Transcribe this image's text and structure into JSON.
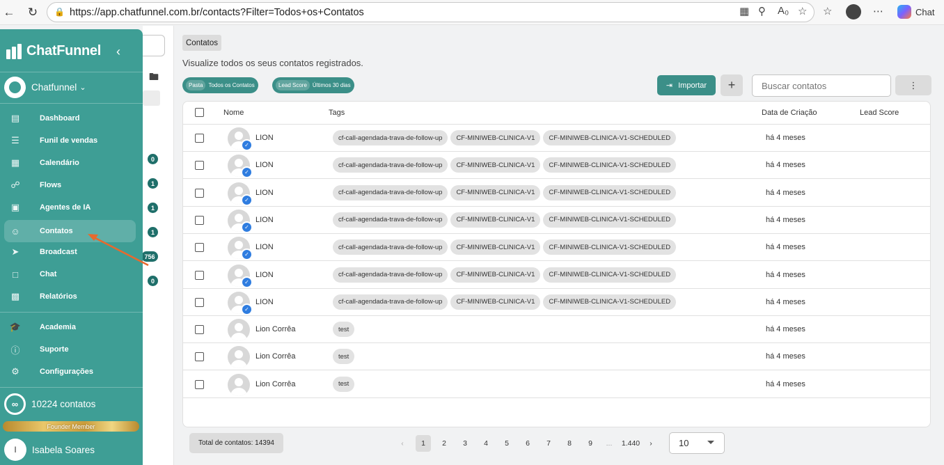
{
  "browser": {
    "url": "https://app.chatfunnel.com.br/contacts?Filter=Todos+os+Contatos",
    "copilot_label": "Chat"
  },
  "sidebar": {
    "brand": "ChatFunnel",
    "workspace": "Chatfunnel",
    "items": [
      {
        "label": "Dashboard",
        "icon": "dashboard-icon"
      },
      {
        "label": "Funil de vendas",
        "icon": "funnel-icon"
      },
      {
        "label": "Calendário",
        "icon": "calendar-icon"
      },
      {
        "label": "Flows",
        "icon": "flows-icon"
      },
      {
        "label": "Agentes de IA",
        "icon": "robot-icon"
      },
      {
        "label": "Contatos",
        "icon": "contacts-icon"
      },
      {
        "label": "Broadcast",
        "icon": "broadcast-icon"
      },
      {
        "label": "Chat",
        "icon": "chat-icon"
      },
      {
        "label": "Relatórios",
        "icon": "reports-icon"
      },
      {
        "label": "Academia",
        "icon": "academy-icon"
      },
      {
        "label": "Suporte",
        "icon": "support-icon"
      },
      {
        "label": "Configurações",
        "icon": "settings-icon"
      }
    ],
    "contacts_count": "10224 contatos",
    "founder_label": "Founder Member",
    "user_initial": "I",
    "user_name": "Isabela Soares"
  },
  "background_counts": [
    "0",
    "1",
    "1",
    "1",
    "756",
    "0"
  ],
  "main": {
    "breadcrumb": "Contatos",
    "subtitle": "Visualize todos os seus contatos registrados.",
    "filters": [
      {
        "key": "Pasta",
        "value": "Todos os Contatos"
      },
      {
        "key": "Lead Score",
        "value": "Últimos 30 dias"
      }
    ],
    "import_label": "Importar",
    "search_placeholder": "Buscar contatos"
  },
  "table": {
    "columns": [
      "Nome",
      "Tags",
      "Data de Criação",
      "Lead Score"
    ],
    "rows": [
      {
        "name": "LION",
        "verified": true,
        "tags": [
          "cf-call-agendada-trava-de-follow-up",
          "CF-MINIWEB-CLINICA-V1",
          "CF-MINIWEB-CLINICA-V1-SCHEDULED"
        ],
        "date": "há 4 meses",
        "score": ""
      },
      {
        "name": "LION",
        "verified": true,
        "tags": [
          "cf-call-agendada-trava-de-follow-up",
          "CF-MINIWEB-CLINICA-V1",
          "CF-MINIWEB-CLINICA-V1-SCHEDULED"
        ],
        "date": "há 4 meses",
        "score": ""
      },
      {
        "name": "LION",
        "verified": true,
        "tags": [
          "cf-call-agendada-trava-de-follow-up",
          "CF-MINIWEB-CLINICA-V1",
          "CF-MINIWEB-CLINICA-V1-SCHEDULED"
        ],
        "date": "há 4 meses",
        "score": ""
      },
      {
        "name": "LION",
        "verified": true,
        "tags": [
          "cf-call-agendada-trava-de-follow-up",
          "CF-MINIWEB-CLINICA-V1",
          "CF-MINIWEB-CLINICA-V1-SCHEDULED"
        ],
        "date": "há 4 meses",
        "score": ""
      },
      {
        "name": "LION",
        "verified": true,
        "tags": [
          "cf-call-agendada-trava-de-follow-up",
          "CF-MINIWEB-CLINICA-V1",
          "CF-MINIWEB-CLINICA-V1-SCHEDULED"
        ],
        "date": "há 4 meses",
        "score": ""
      },
      {
        "name": "LION",
        "verified": true,
        "tags": [
          "cf-call-agendada-trava-de-follow-up",
          "CF-MINIWEB-CLINICA-V1",
          "CF-MINIWEB-CLINICA-V1-SCHEDULED"
        ],
        "date": "há 4 meses",
        "score": ""
      },
      {
        "name": "LION",
        "verified": true,
        "tags": [
          "cf-call-agendada-trava-de-follow-up",
          "CF-MINIWEB-CLINICA-V1",
          "CF-MINIWEB-CLINICA-V1-SCHEDULED"
        ],
        "date": "há 4 meses",
        "score": ""
      },
      {
        "name": "Lion Corrêa",
        "verified": false,
        "tags": [
          "test"
        ],
        "date": "há 4 meses",
        "score": ""
      },
      {
        "name": "Lion Corrêa",
        "verified": false,
        "tags": [
          "test"
        ],
        "date": "há 4 meses",
        "score": ""
      },
      {
        "name": "Lion Corrêa",
        "verified": false,
        "tags": [
          "test"
        ],
        "date": "há 4 meses",
        "score": ""
      }
    ]
  },
  "footer": {
    "total": "Total de contatos: 14394",
    "pages": [
      "1",
      "2",
      "3",
      "4",
      "5",
      "6",
      "7",
      "8",
      "9",
      "...",
      "1.440"
    ],
    "current_page": "1",
    "per_page": "10"
  },
  "colors": {
    "sidebar": "#3e9e95",
    "accent": "#3b8f88",
    "annotation_arrow": "#e8692d",
    "verified_badge": "#2f7de0"
  }
}
